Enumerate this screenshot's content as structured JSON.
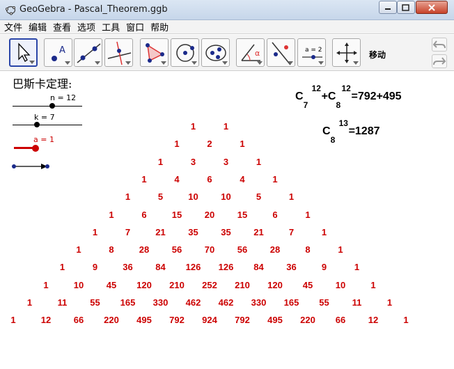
{
  "window": {
    "title": "GeoGebra - Pascal_Theorem.ggb"
  },
  "menu": [
    "文件",
    "编辑",
    "查看",
    "选项",
    "工具",
    "窗口",
    "帮助"
  ],
  "toolbar": {
    "active_tool_label": "移动",
    "tools": [
      "move-tool",
      "point-tool",
      "line-tool",
      "perpendicular-line-tool",
      "polygon-tool",
      "circle-tool",
      "conic-tool",
      "angle-tool",
      "reflect-tool",
      "slider-tool",
      "move-view-tool"
    ],
    "slider_tool_text": "a = 2"
  },
  "canvas": {
    "heading": "巴斯卡定理:",
    "sliders": [
      {
        "label": "n = 12",
        "value": 12
      },
      {
        "label": "k = 7",
        "value": 7
      },
      {
        "label": "a = 1",
        "value": 1
      }
    ],
    "formula1": {
      "c1_sup": "12",
      "c1_sub": "7",
      "plus": "+",
      "c2_sup": "12",
      "c2_sub": "8",
      "rhs": "=792+495"
    },
    "formula2": {
      "c_sup": "13",
      "c_sub": "8",
      "rhs": "=1287"
    },
    "pascal_rows": [
      [
        "1",
        "1"
      ],
      [
        "1",
        "2",
        "1"
      ],
      [
        "1",
        "3",
        "3",
        "1"
      ],
      [
        "1",
        "4",
        "6",
        "4",
        "1"
      ],
      [
        "1",
        "5",
        "10",
        "10",
        "5",
        "1"
      ],
      [
        "1",
        "6",
        "15",
        "20",
        "15",
        "6",
        "1"
      ],
      [
        "1",
        "7",
        "21",
        "35",
        "35",
        "21",
        "7",
        "1"
      ],
      [
        "1",
        "8",
        "28",
        "56",
        "70",
        "56",
        "28",
        "8",
        "1"
      ],
      [
        "1",
        "9",
        "36",
        "84",
        "126",
        "126",
        "84",
        "36",
        "9",
        "1"
      ],
      [
        "1",
        "10",
        "45",
        "120",
        "210",
        "252",
        "210",
        "120",
        "45",
        "10",
        "1"
      ],
      [
        "1",
        "11",
        "55",
        "165",
        "330",
        "462",
        "462",
        "330",
        "165",
        "55",
        "11",
        "1"
      ],
      [
        "1",
        "12",
        "66",
        "220",
        "495",
        "792",
        "924",
        "792",
        "495",
        "220",
        "66",
        "12",
        "1"
      ]
    ]
  },
  "colors": {
    "number_red": "#cc0000",
    "accent_blue": "#2a45a8"
  }
}
